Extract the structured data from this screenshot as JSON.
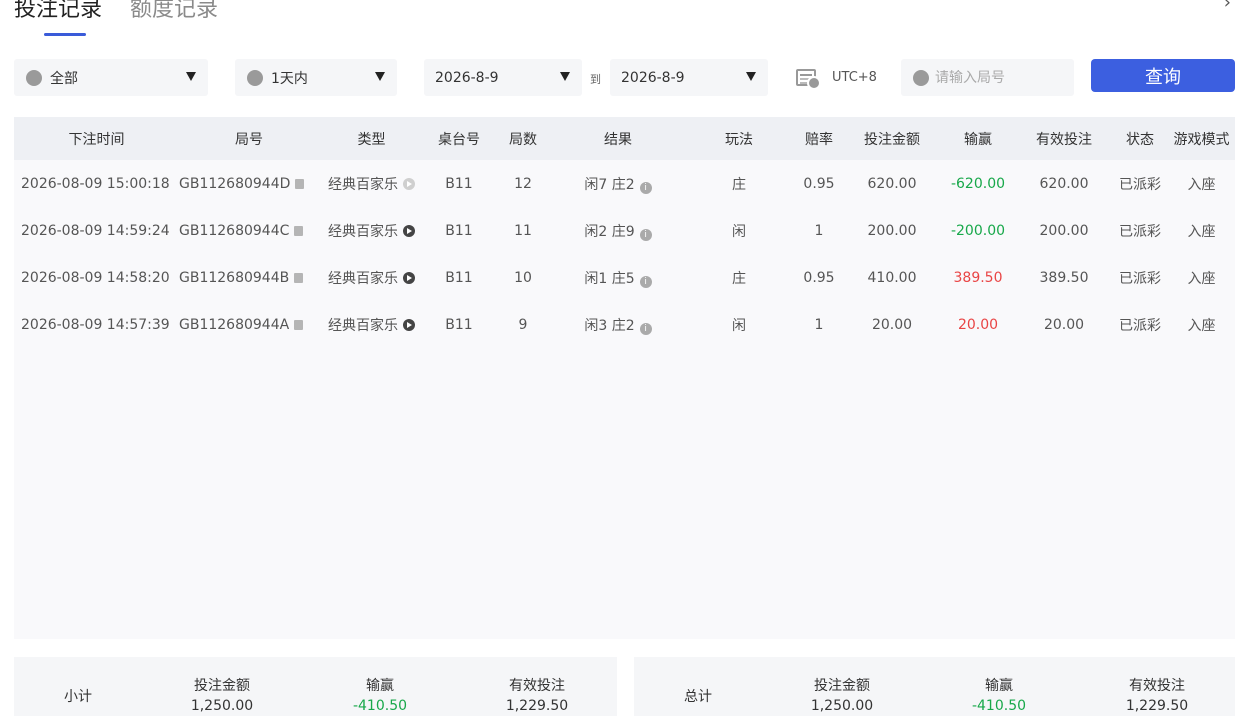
{
  "tabs": [
    {
      "label": "投注记录",
      "active": true
    },
    {
      "label": "额度记录",
      "active": false
    }
  ],
  "close_icon": "close-icon",
  "filters": {
    "game_select": "全部",
    "range_select": "1天内",
    "date_from": "2026-8-9",
    "to_label": "到",
    "date_to": "2026-8-9",
    "timezone": "UTC+8",
    "search_placeholder": "请输入局号",
    "query_label": "查询"
  },
  "table": {
    "headers": [
      "下注时间",
      "局号",
      "类型",
      "桌台号",
      "局数",
      "结果",
      "玩法",
      "赔率",
      "投注金额",
      "输赢",
      "有效投注",
      "状态",
      "游戏模式"
    ],
    "rows": [
      {
        "time": "2026-08-09 15:00:18",
        "round": "GB112680944D",
        "type": "经典百家乐",
        "table": "B11",
        "count": "12",
        "result": "闲7 庄2",
        "play": "庄",
        "odds": "0.95",
        "amount": "620.00",
        "winloss": "-620.00",
        "valid": "620.00",
        "status": "已派彩",
        "mode": "入座"
      },
      {
        "time": "2026-08-09 14:59:24",
        "round": "GB112680944C",
        "type": "经典百家乐",
        "table": "B11",
        "count": "11",
        "result": "闲2 庄9",
        "play": "闲",
        "odds": "1",
        "amount": "200.00",
        "winloss": "-200.00",
        "valid": "200.00",
        "status": "已派彩",
        "mode": "入座"
      },
      {
        "time": "2026-08-09 14:58:20",
        "round": "GB112680944B",
        "type": "经典百家乐",
        "table": "B11",
        "count": "10",
        "result": "闲1 庄5",
        "play": "庄",
        "odds": "0.95",
        "amount": "410.00",
        "winloss": "389.50",
        "valid": "389.50",
        "status": "已派彩",
        "mode": "入座"
      },
      {
        "time": "2026-08-09 14:57:39",
        "round": "GB112680944A",
        "type": "经典百家乐",
        "table": "B11",
        "count": "9",
        "result": "闲3 庄2",
        "play": "闲",
        "odds": "1",
        "amount": "20.00",
        "winloss": "20.00",
        "valid": "20.00",
        "status": "已派彩",
        "mode": "入座"
      }
    ]
  },
  "subtotal": {
    "label": "小计",
    "amount_label": "投注金额",
    "amount": "1,250.00",
    "winloss_label": "输赢",
    "winloss": "-410.50",
    "valid_label": "有效投注",
    "valid": "1,229.50"
  },
  "total": {
    "label": "总计",
    "amount_label": "投注金额",
    "amount": "1,250.00",
    "winloss_label": "输赢",
    "winloss": "-410.50",
    "valid_label": "有效投注",
    "valid": "1,229.50"
  },
  "colors": {
    "accent": "#3c5fe0",
    "loss": "#18a84a",
    "win": "#e94545"
  }
}
